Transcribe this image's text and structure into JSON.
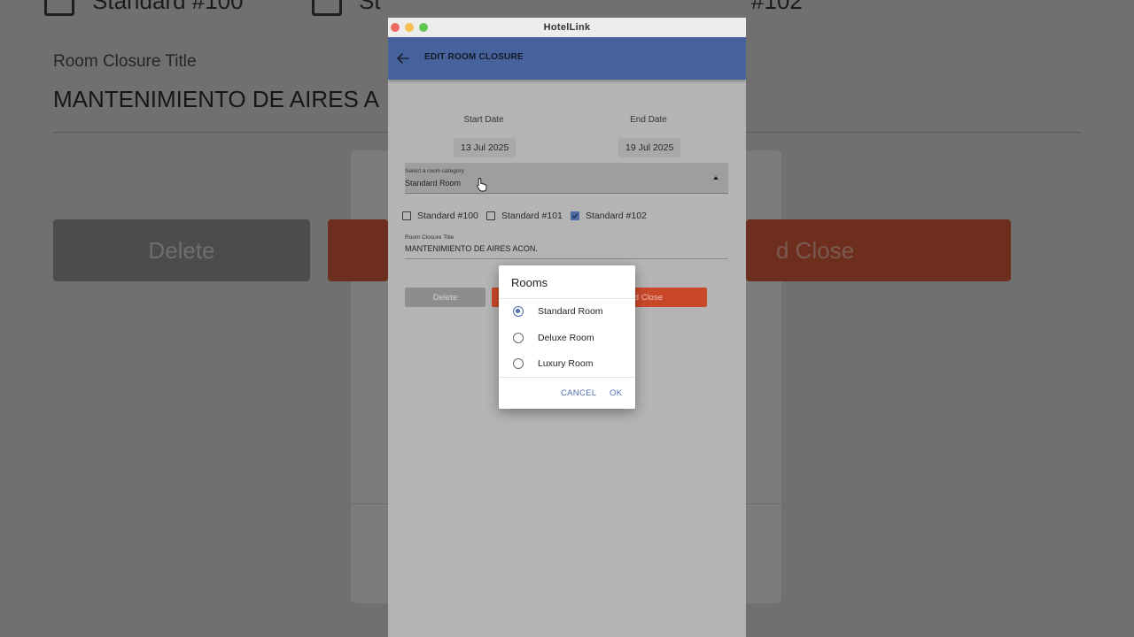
{
  "background": {
    "checkbox_100_label": "Standard #100",
    "checkbox_101_label": "St",
    "checkbox_102_label": "#102",
    "closure_title_label": "Room Closure Title",
    "closure_title_value": "MANTENIMIENTO DE AIRES A",
    "delete_label": "Delete",
    "save_label": "d Close"
  },
  "window": {
    "title": "HotelLink",
    "traffic_colors": {
      "close": "#ed6a5e",
      "minimize": "#f5bf4f",
      "maximize": "#61c554"
    }
  },
  "appbar": {
    "title": "EDIT ROOM CLOSURE",
    "back_icon": "arrow-left-icon",
    "color": "#47639e"
  },
  "dates": {
    "start_label": "Start Date",
    "start_value": "13 Jul 2025",
    "end_label": "End Date",
    "end_value": "19 Jul 2025"
  },
  "room_category": {
    "label": "Select a room category",
    "value": "Standard Room",
    "dropdown_icon": "triangle-up-icon"
  },
  "rooms": [
    {
      "label": "Standard #100",
      "checked": false
    },
    {
      "label": "Standard #101",
      "checked": false
    },
    {
      "label": "Standard #102",
      "checked": true
    }
  ],
  "closure_title": {
    "label": "Room Closure Title",
    "value": "MANTENIMIENTO DE AIRES ACON."
  },
  "actions": {
    "delete_label": "Delete",
    "save_label": "d Close",
    "save_color": "#c9482a"
  },
  "dialog": {
    "title": "Rooms",
    "options": [
      {
        "label": "Standard Room",
        "selected": true
      },
      {
        "label": "Deluxe Room",
        "selected": false
      },
      {
        "label": "Luxury Room",
        "selected": false
      }
    ],
    "cancel_label": "CANCEL",
    "ok_label": "OK",
    "accent": "#4c6cb0"
  }
}
